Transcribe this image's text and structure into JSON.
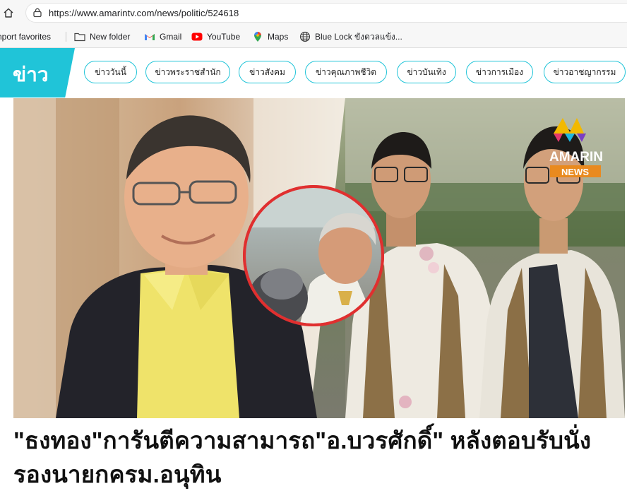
{
  "browser": {
    "url": "https://www.amarintv.com/news/politic/524618",
    "bookmarks": [
      {
        "label": "nport favorites",
        "icon": "none"
      },
      {
        "label": "New folder",
        "icon": "folder-icon"
      },
      {
        "label": "Gmail",
        "icon": "gmail-icon"
      },
      {
        "label": "YouTube",
        "icon": "youtube-icon"
      },
      {
        "label": "Maps",
        "icon": "maps-icon"
      },
      {
        "label": "Blue Lock ขังดวลแข้ง...",
        "icon": "globe-icon"
      }
    ]
  },
  "site": {
    "brand_label": "ข่าว",
    "brand_color": "#20c4d8",
    "nav_items": [
      "ข่าววันนี้",
      "ข่าวพระราชสำนัก",
      "ข่าวสังคม",
      "ข่าวคุณภาพชีวิต",
      "ข่าวบันเทิง",
      "ข่าวการเมือง",
      "ข่าวอาชญากรรม"
    ]
  },
  "hero": {
    "logo_text": "AMARIN",
    "logo_badge": "NEWS"
  },
  "article": {
    "headline": "\"ธงทอง\"การันตีความสามารถ\"อ.บวรศักดิ์\" หลังตอบรับนั่งรองนายกครม.อนุทิน"
  }
}
